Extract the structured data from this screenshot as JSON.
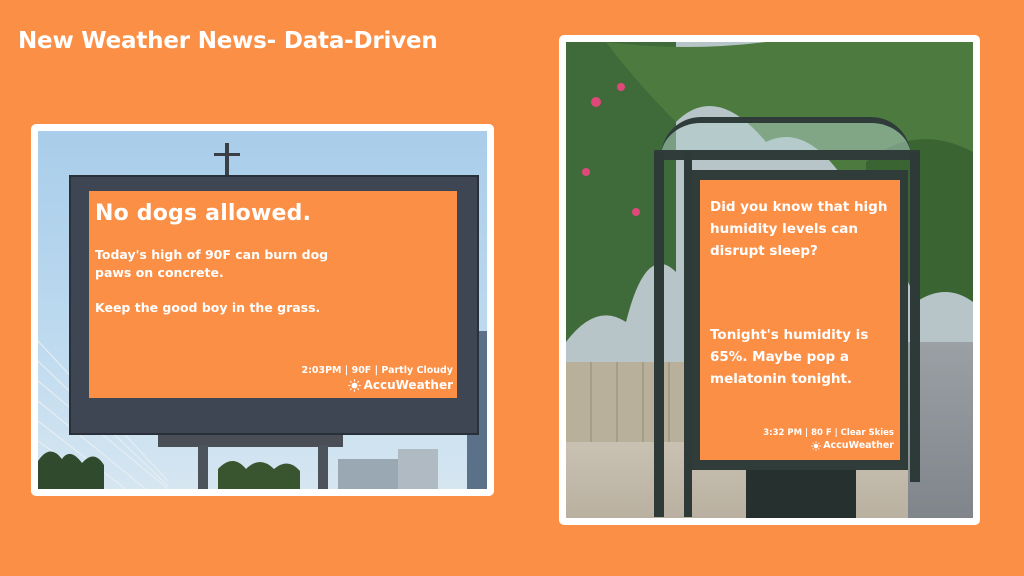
{
  "slide": {
    "title": "New Weather News- Data-Driven"
  },
  "billboard": {
    "headline": "No dogs allowed.",
    "body": "Today's high of 90F can burn dog paws on concrete.",
    "body2": "Keep the good boy in the grass.",
    "stamp": "2:03PM | 90F | Partly Cloudy",
    "brand": "AccuWeather"
  },
  "shelter": {
    "headline": "Did you know that high humidity levels can disrupt sleep?",
    "body": "Tonight's humidity is 65%. Maybe pop a melatonin tonight.",
    "stamp": "3:32 PM | 80 F | Clear Skies",
    "brand": "AccuWeather"
  },
  "colors": {
    "background": "#fb8f46",
    "ad_panel": "#fb8f46",
    "text": "#ffffff"
  },
  "icons": {
    "brand_logo": "sun-icon"
  }
}
